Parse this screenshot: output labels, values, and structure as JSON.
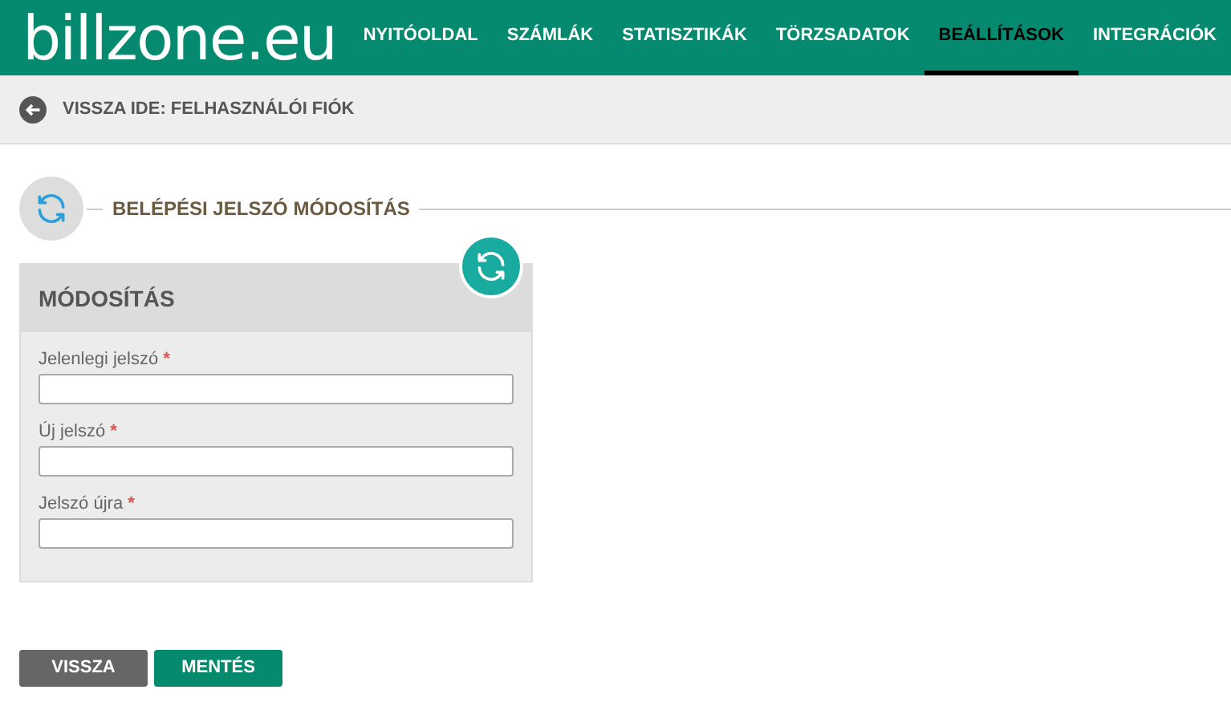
{
  "header": {
    "logo": "billzone.eu",
    "nav": [
      {
        "label": "NYITÓOLDAL",
        "selected": false
      },
      {
        "label": "SZÁMLÁK",
        "selected": false
      },
      {
        "label": "STATISZTIKÁK",
        "selected": false
      },
      {
        "label": "TÖRZSADATOK",
        "selected": false
      },
      {
        "label": "BEÁLLÍTÁSOK",
        "selected": true
      },
      {
        "label": "INTEGRÁCIÓK",
        "selected": false
      }
    ]
  },
  "back_link": "VISSZA IDE: FELHASZNÁLÓI FIÓK",
  "section_title": "BELÉPÉSI JELSZÓ MÓDOSÍTÁS",
  "card": {
    "title": "MÓDOSÍTÁS",
    "fields": [
      {
        "label": "Jelenlegi jelszó",
        "required_mark": "*"
      },
      {
        "label": "Új jelszó",
        "required_mark": "*"
      },
      {
        "label": "Jelszó újra",
        "required_mark": "*"
      }
    ]
  },
  "buttons": [
    {
      "label": "VISSZA",
      "kind": "secondary"
    },
    {
      "label": "MENTÉS",
      "kind": "primary"
    }
  ]
}
